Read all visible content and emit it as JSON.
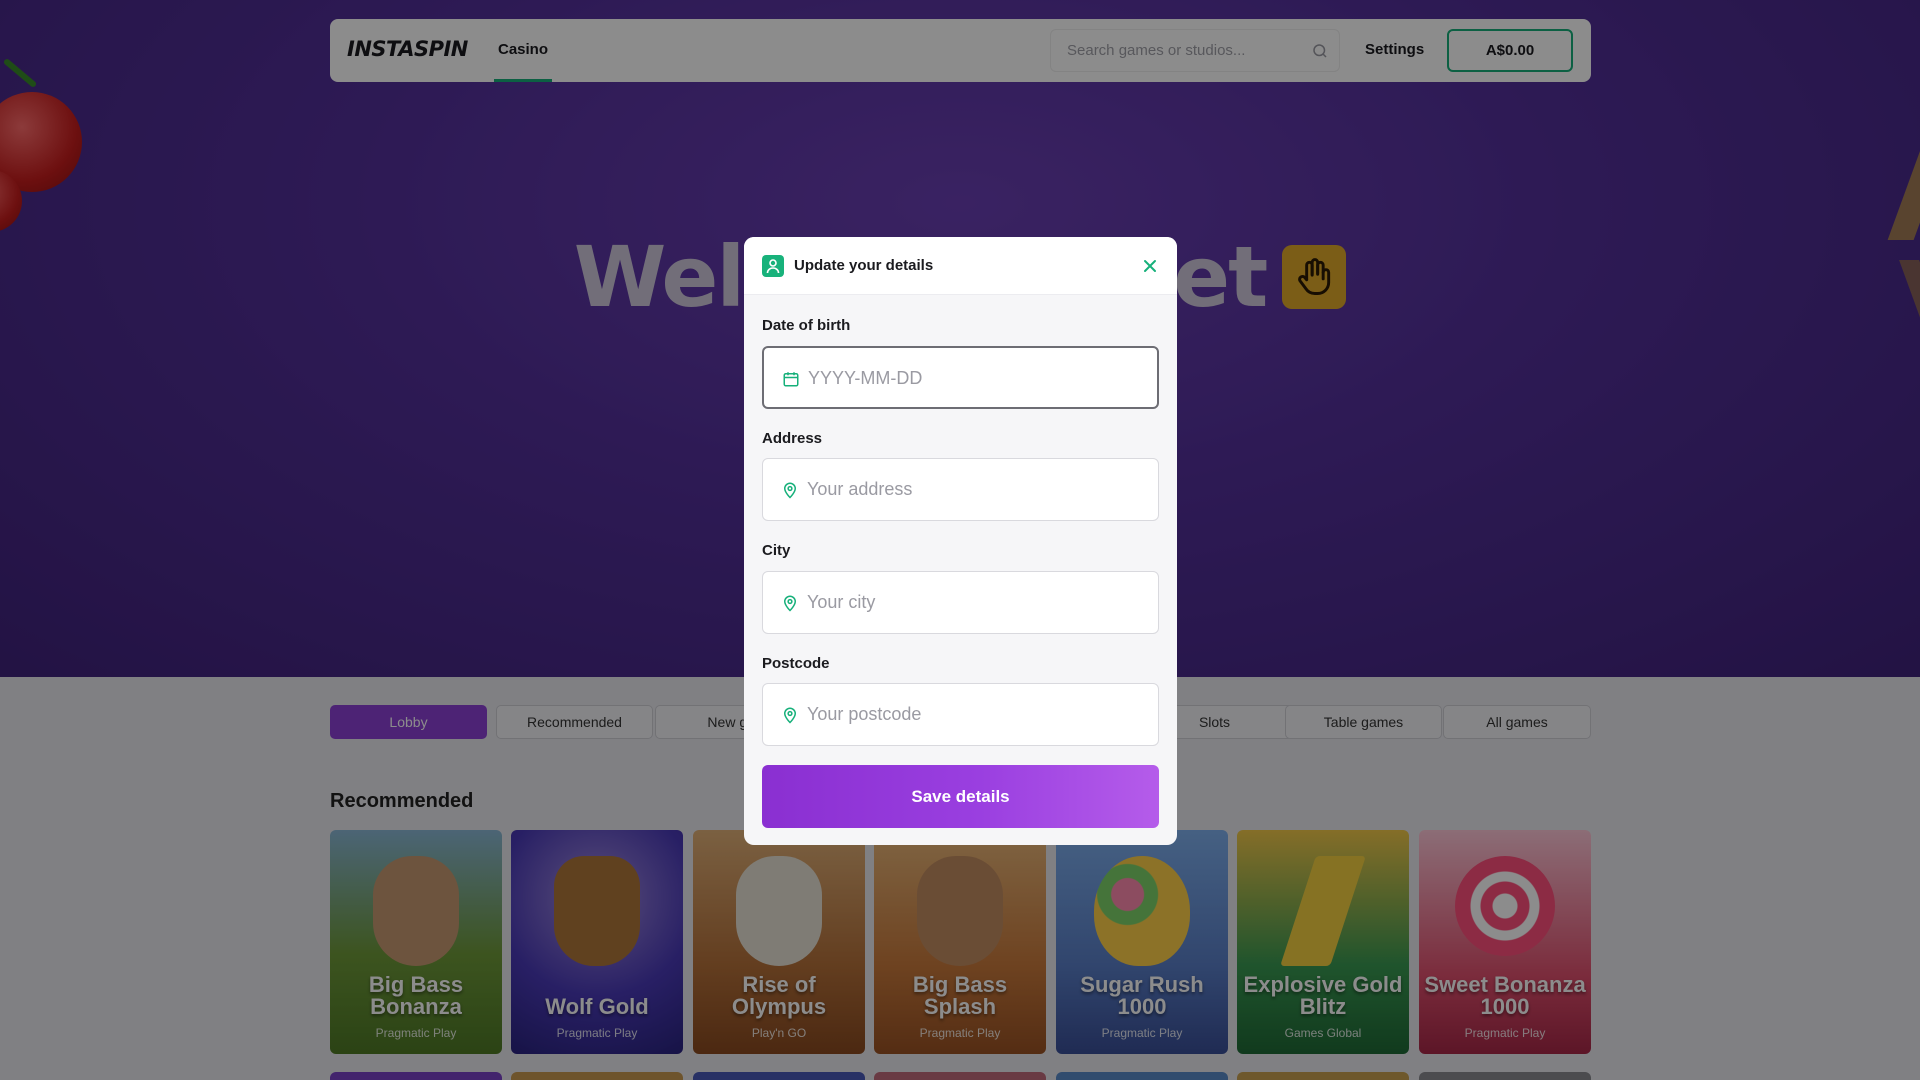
{
  "header": {
    "logo": "INSTASPIN",
    "nav_casino": "Casino",
    "search_placeholder": "Search games or studios...",
    "settings": "Settings",
    "balance": "A$0.00"
  },
  "hero": {
    "title_left": "Wel",
    "title_right": "et"
  },
  "tabs": [
    "Lobby",
    "Recommended",
    "New gar",
    "Slots",
    "Table games",
    "All games"
  ],
  "section_title": "Recommended",
  "games": [
    {
      "name": "Big Bass Bonanza",
      "studio": "Pragmatic Play",
      "color": "#6f9a3a"
    },
    {
      "name": "Wolf Gold",
      "studio": "Pragmatic Play",
      "color": "#3a3aa8"
    },
    {
      "name": "Rise of Olympus",
      "studio": "Play'n GO",
      "color": "#b5713a"
    },
    {
      "name": "Big Bass Splash",
      "studio": "Pragmatic Play",
      "color": "#c97a3c"
    },
    {
      "name": "Sugar Rush 1000",
      "studio": "Pragmatic Play",
      "color": "#5a7fc8"
    },
    {
      "name": "Explosive Gold Blitz",
      "studio": "Games Global",
      "color": "#3a9a52"
    },
    {
      "name": "Sweet Bonanza 1000",
      "studio": "Pragmatic Play",
      "color": "#e0506e"
    }
  ],
  "modal": {
    "title": "Update your details",
    "dob_label": "Date of birth",
    "dob_placeholder": "YYYY-MM-DD",
    "address_label": "Address",
    "address_placeholder": "Your address",
    "city_label": "City",
    "city_placeholder": "Your city",
    "postcode_label": "Postcode",
    "postcode_placeholder": "Your postcode",
    "save_label": "Save details"
  },
  "colors": {
    "accent_green": "#16b07a",
    "accent_purple": "#8d41d6"
  }
}
